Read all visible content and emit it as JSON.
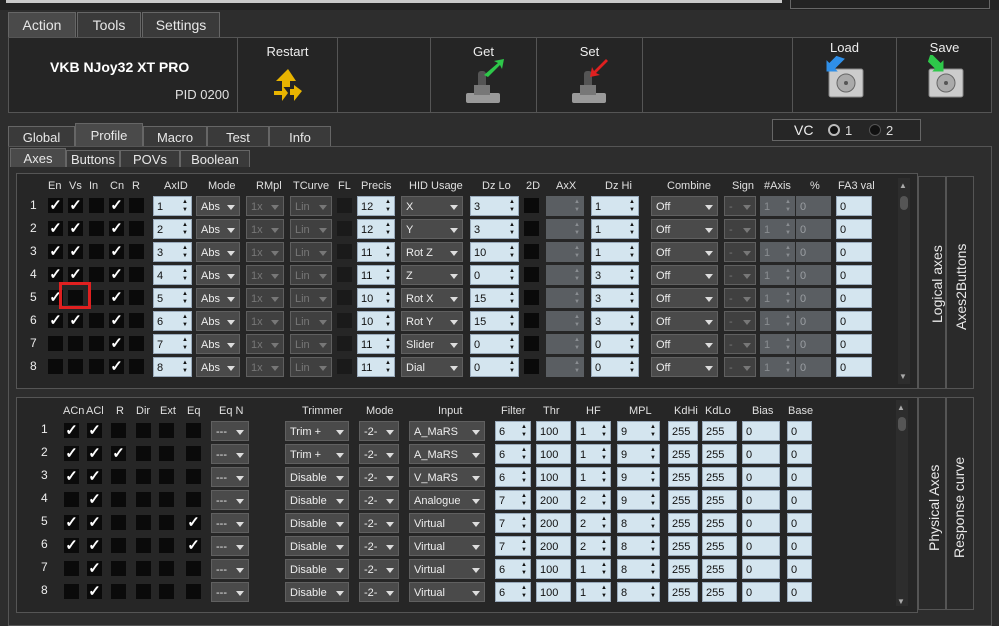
{
  "tabs": [
    "Action",
    "Tools",
    "Settings"
  ],
  "device": {
    "name": "VKB NJoy32 XT PRO",
    "pid": "PID 0200"
  },
  "actions": {
    "restart": "Restart",
    "get": "Get",
    "set": "Set",
    "load": "Load",
    "save": "Save"
  },
  "profile_tabs": [
    "Global",
    "Profile",
    "Macro",
    "Test",
    "Info"
  ],
  "vc": {
    "label": "VC",
    "opt1": "1",
    "opt2": "2"
  },
  "sub_tabs": [
    "Axes",
    "Buttons",
    "POVs",
    "Boolean"
  ],
  "logical": {
    "title": "Logical axes",
    "side2": "Axes2Buttons",
    "headers": [
      "En",
      "Vs",
      "In",
      "Cn",
      "R",
      "AxID",
      "Mode",
      "RMpl",
      "TCurve",
      "FL",
      "Precis",
      "HID Usage",
      "Dz Lo",
      "2D",
      "AxX",
      "Dz Hi",
      "Combine",
      "Sign",
      "#Axis",
      "%",
      "FA3 val"
    ],
    "rows": [
      {
        "n": "1",
        "en": true,
        "vs": true,
        "in": false,
        "cn": true,
        "r": false,
        "axid": "1",
        "mode": "Abs",
        "rmpl": "1x",
        "tcurve": "Lin",
        "precis": "12",
        "hid": "X",
        "dzlo": "3",
        "dzhi": "1",
        "combine": "Off",
        "sign": "-",
        "axis": "1",
        "pct": "0",
        "fa3": "0"
      },
      {
        "n": "2",
        "en": true,
        "vs": true,
        "in": false,
        "cn": true,
        "r": false,
        "axid": "2",
        "mode": "Abs",
        "rmpl": "1x",
        "tcurve": "Lin",
        "precis": "12",
        "hid": "Y",
        "dzlo": "3",
        "dzhi": "1",
        "combine": "Off",
        "sign": "-",
        "axis": "1",
        "pct": "0",
        "fa3": "0"
      },
      {
        "n": "3",
        "en": true,
        "vs": true,
        "in": false,
        "cn": true,
        "r": false,
        "axid": "3",
        "mode": "Abs",
        "rmpl": "1x",
        "tcurve": "Lin",
        "precis": "11",
        "hid": "Rot Z",
        "dzlo": "10",
        "dzhi": "1",
        "combine": "Off",
        "sign": "-",
        "axis": "1",
        "pct": "0",
        "fa3": "0"
      },
      {
        "n": "4",
        "en": true,
        "vs": true,
        "in": false,
        "cn": true,
        "r": false,
        "axid": "4",
        "mode": "Abs",
        "rmpl": "1x",
        "tcurve": "Lin",
        "precis": "11",
        "hid": "Z",
        "dzlo": "0",
        "dzhi": "3",
        "combine": "Off",
        "sign": "-",
        "axis": "1",
        "pct": "0",
        "fa3": "0"
      },
      {
        "n": "5",
        "en": true,
        "vs": false,
        "in": false,
        "cn": true,
        "r": false,
        "axid": "5",
        "mode": "Abs",
        "rmpl": "1x",
        "tcurve": "Lin",
        "precis": "10",
        "hid": "Rot X",
        "dzlo": "15",
        "dzhi": "3",
        "combine": "Off",
        "sign": "-",
        "axis": "1",
        "pct": "0",
        "fa3": "0"
      },
      {
        "n": "6",
        "en": true,
        "vs": true,
        "in": false,
        "cn": true,
        "r": false,
        "axid": "6",
        "mode": "Abs",
        "rmpl": "1x",
        "tcurve": "Lin",
        "precis": "10",
        "hid": "Rot Y",
        "dzlo": "15",
        "dzhi": "3",
        "combine": "Off",
        "sign": "-",
        "axis": "1",
        "pct": "0",
        "fa3": "0"
      },
      {
        "n": "7",
        "en": false,
        "vs": false,
        "in": false,
        "cn": true,
        "r": false,
        "axid": "7",
        "mode": "Abs",
        "rmpl": "1x",
        "tcurve": "Lin",
        "precis": "11",
        "hid": "Slider",
        "dzlo": "0",
        "dzhi": "0",
        "combine": "Off",
        "sign": "-",
        "axis": "1",
        "pct": "0",
        "fa3": "0"
      },
      {
        "n": "8",
        "en": false,
        "vs": false,
        "in": false,
        "cn": true,
        "r": false,
        "axid": "8",
        "mode": "Abs",
        "rmpl": "1x",
        "tcurve": "Lin",
        "precis": "11",
        "hid": "Dial",
        "dzlo": "0",
        "dzhi": "0",
        "combine": "Off",
        "sign": "-",
        "axis": "1",
        "pct": "0",
        "fa3": "0"
      }
    ]
  },
  "physical": {
    "title": "Physical Axes",
    "side2": "Response curve",
    "headers": [
      "ACn",
      "ACl",
      "R",
      "Dir",
      "Ext",
      "Eq",
      "Eq N",
      "Trimmer",
      "Mode",
      "Input",
      "Filter",
      "Thr",
      "HF",
      "MPL",
      "KdHi",
      "KdLo",
      "Bias",
      "Base"
    ],
    "rows": [
      {
        "n": "1",
        "acn": true,
        "acl": true,
        "r": false,
        "eq": false,
        "eqn": "---",
        "trim": "Trim +",
        "mode": "-2-",
        "input": "A_MaRS",
        "filter": "6",
        "thr": "100",
        "hf": "1",
        "mpl": "9",
        "kdhi": "255",
        "kdlo": "255",
        "bias": "0",
        "base": "0"
      },
      {
        "n": "2",
        "acn": true,
        "acl": true,
        "r": true,
        "eq": false,
        "eqn": "---",
        "trim": "Trim +",
        "mode": "-2-",
        "input": "A_MaRS",
        "filter": "6",
        "thr": "100",
        "hf": "1",
        "mpl": "9",
        "kdhi": "255",
        "kdlo": "255",
        "bias": "0",
        "base": "0"
      },
      {
        "n": "3",
        "acn": true,
        "acl": true,
        "r": false,
        "eq": false,
        "eqn": "---",
        "trim": "Disable",
        "mode": "-2-",
        "input": "V_MaRS",
        "filter": "6",
        "thr": "100",
        "hf": "1",
        "mpl": "9",
        "kdhi": "255",
        "kdlo": "255",
        "bias": "0",
        "base": "0"
      },
      {
        "n": "4",
        "acn": false,
        "acl": true,
        "r": false,
        "eq": false,
        "eqn": "---",
        "trim": "Disable",
        "mode": "-2-",
        "input": "Analogue",
        "filter": "7",
        "thr": "200",
        "hf": "2",
        "mpl": "9",
        "kdhi": "255",
        "kdlo": "255",
        "bias": "0",
        "base": "0"
      },
      {
        "n": "5",
        "acn": true,
        "acl": true,
        "r": false,
        "eq": true,
        "eqn": "---",
        "trim": "Disable",
        "mode": "-2-",
        "input": "Virtual",
        "filter": "7",
        "thr": "200",
        "hf": "2",
        "mpl": "8",
        "kdhi": "255",
        "kdlo": "255",
        "bias": "0",
        "base": "0"
      },
      {
        "n": "6",
        "acn": true,
        "acl": true,
        "r": false,
        "eq": true,
        "eqn": "---",
        "trim": "Disable",
        "mode": "-2-",
        "input": "Virtual",
        "filter": "7",
        "thr": "200",
        "hf": "2",
        "mpl": "8",
        "kdhi": "255",
        "kdlo": "255",
        "bias": "0",
        "base": "0"
      },
      {
        "n": "7",
        "acn": false,
        "acl": true,
        "r": false,
        "eq": false,
        "eqn": "---",
        "trim": "Disable",
        "mode": "-2-",
        "input": "Virtual",
        "filter": "6",
        "thr": "100",
        "hf": "1",
        "mpl": "8",
        "kdhi": "255",
        "kdlo": "255",
        "bias": "0",
        "base": "0"
      },
      {
        "n": "8",
        "acn": false,
        "acl": true,
        "r": false,
        "eq": false,
        "eqn": "---",
        "trim": "Disable",
        "mode": "-2-",
        "input": "Virtual",
        "filter": "6",
        "thr": "100",
        "hf": "1",
        "mpl": "8",
        "kdhi": "255",
        "kdlo": "255",
        "bias": "0",
        "base": "0"
      }
    ]
  },
  "colors": {
    "highlight": "#e02020",
    "field": "#d4e5ef"
  }
}
